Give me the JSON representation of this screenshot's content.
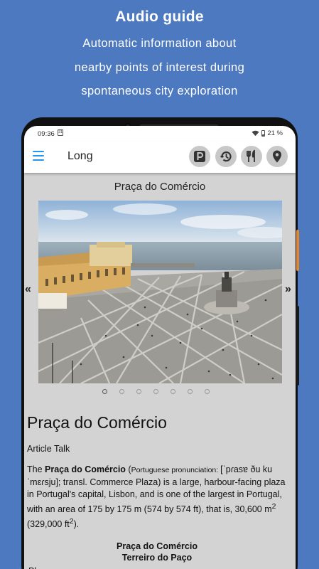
{
  "promo": {
    "title": "Audio guide",
    "lines": [
      "Automatic information about",
      "nearby points of interest during",
      "spontaneous city exploration"
    ]
  },
  "status_bar": {
    "time": "09:36",
    "calendar_day": "31",
    "battery": "21 %"
  },
  "appbar": {
    "title": "Long",
    "actions": [
      "parking-icon",
      "history-icon",
      "restaurant-icon",
      "location-pin-icon"
    ]
  },
  "place": {
    "heading": "Praça do Comércio",
    "carousel": {
      "prev": "«",
      "next": "»",
      "slide_count": 7,
      "active_index": 0
    }
  },
  "article": {
    "title": "Praça do Comércio",
    "tabs": "Article Talk",
    "intro_prefix": "The ",
    "intro_bold": "Praça do Comércio",
    "intro_paren_open": " (",
    "pronunciation_label": "Portuguese pronunciation: ",
    "pronunciation": "[ˈpɾasɐ ðu kuˈmɛɾsju]",
    "intro_rest": "; transl. Commerce Plaza) is a large, harbour-facing plaza in Portugal's capital, Lisbon, and is one of the largest in Portugal, with an area of 175 by 175 m (574 by 574 ft), that is, 30,600 m",
    "intro_sup1": "2",
    "intro_mid": " (329,000 ft",
    "intro_sup2": "2",
    "intro_end": ").",
    "infobox_name": "Praça do Comércio",
    "infobox_alt_name": "Terreiro do Paço",
    "infobox_type": "Plaza"
  },
  "colors": {
    "background": "#4d79c1",
    "accent": "#2196f3",
    "side_button": "#e38630"
  }
}
